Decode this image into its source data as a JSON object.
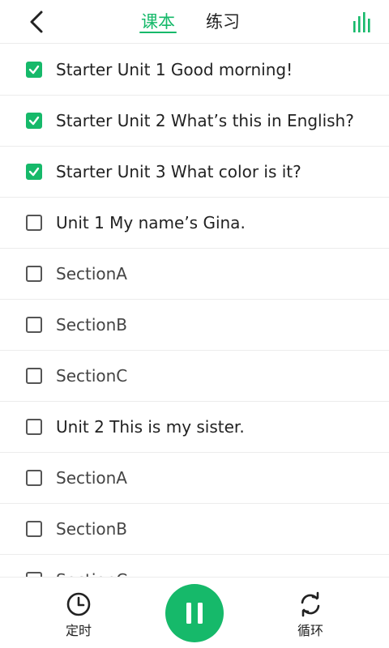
{
  "header": {
    "tabs": [
      "课本",
      "练习"
    ],
    "active_tab": 0,
    "accent_color": "#16b96a",
    "back_icon": "chevron-left-icon",
    "stats_icon": "bar-chart-icon"
  },
  "list": {
    "items": [
      {
        "label": "Starter Unit 1 Good morning!",
        "checked": true
      },
      {
        "label": "Starter Unit 2 What’s this in English?",
        "checked": true
      },
      {
        "label": "Starter Unit 3 What color is it?",
        "checked": true
      },
      {
        "label": "Unit 1 My name’s Gina.",
        "checked": false
      },
      {
        "label": "SectionA",
        "checked": false
      },
      {
        "label": "SectionB",
        "checked": false
      },
      {
        "label": "SectionC",
        "checked": false
      },
      {
        "label": "Unit 2 This is my sister.",
        "checked": false
      },
      {
        "label": "SectionA",
        "checked": false
      },
      {
        "label": "SectionB",
        "checked": false
      },
      {
        "label": "SectionC",
        "checked": false
      }
    ]
  },
  "bottom_bar": {
    "timer_label": "定时",
    "timer_icon": "clock-icon",
    "play_state": "playing",
    "pause_icon": "pause-icon",
    "loop_label": "循环",
    "loop_icon": "loop-icon"
  }
}
